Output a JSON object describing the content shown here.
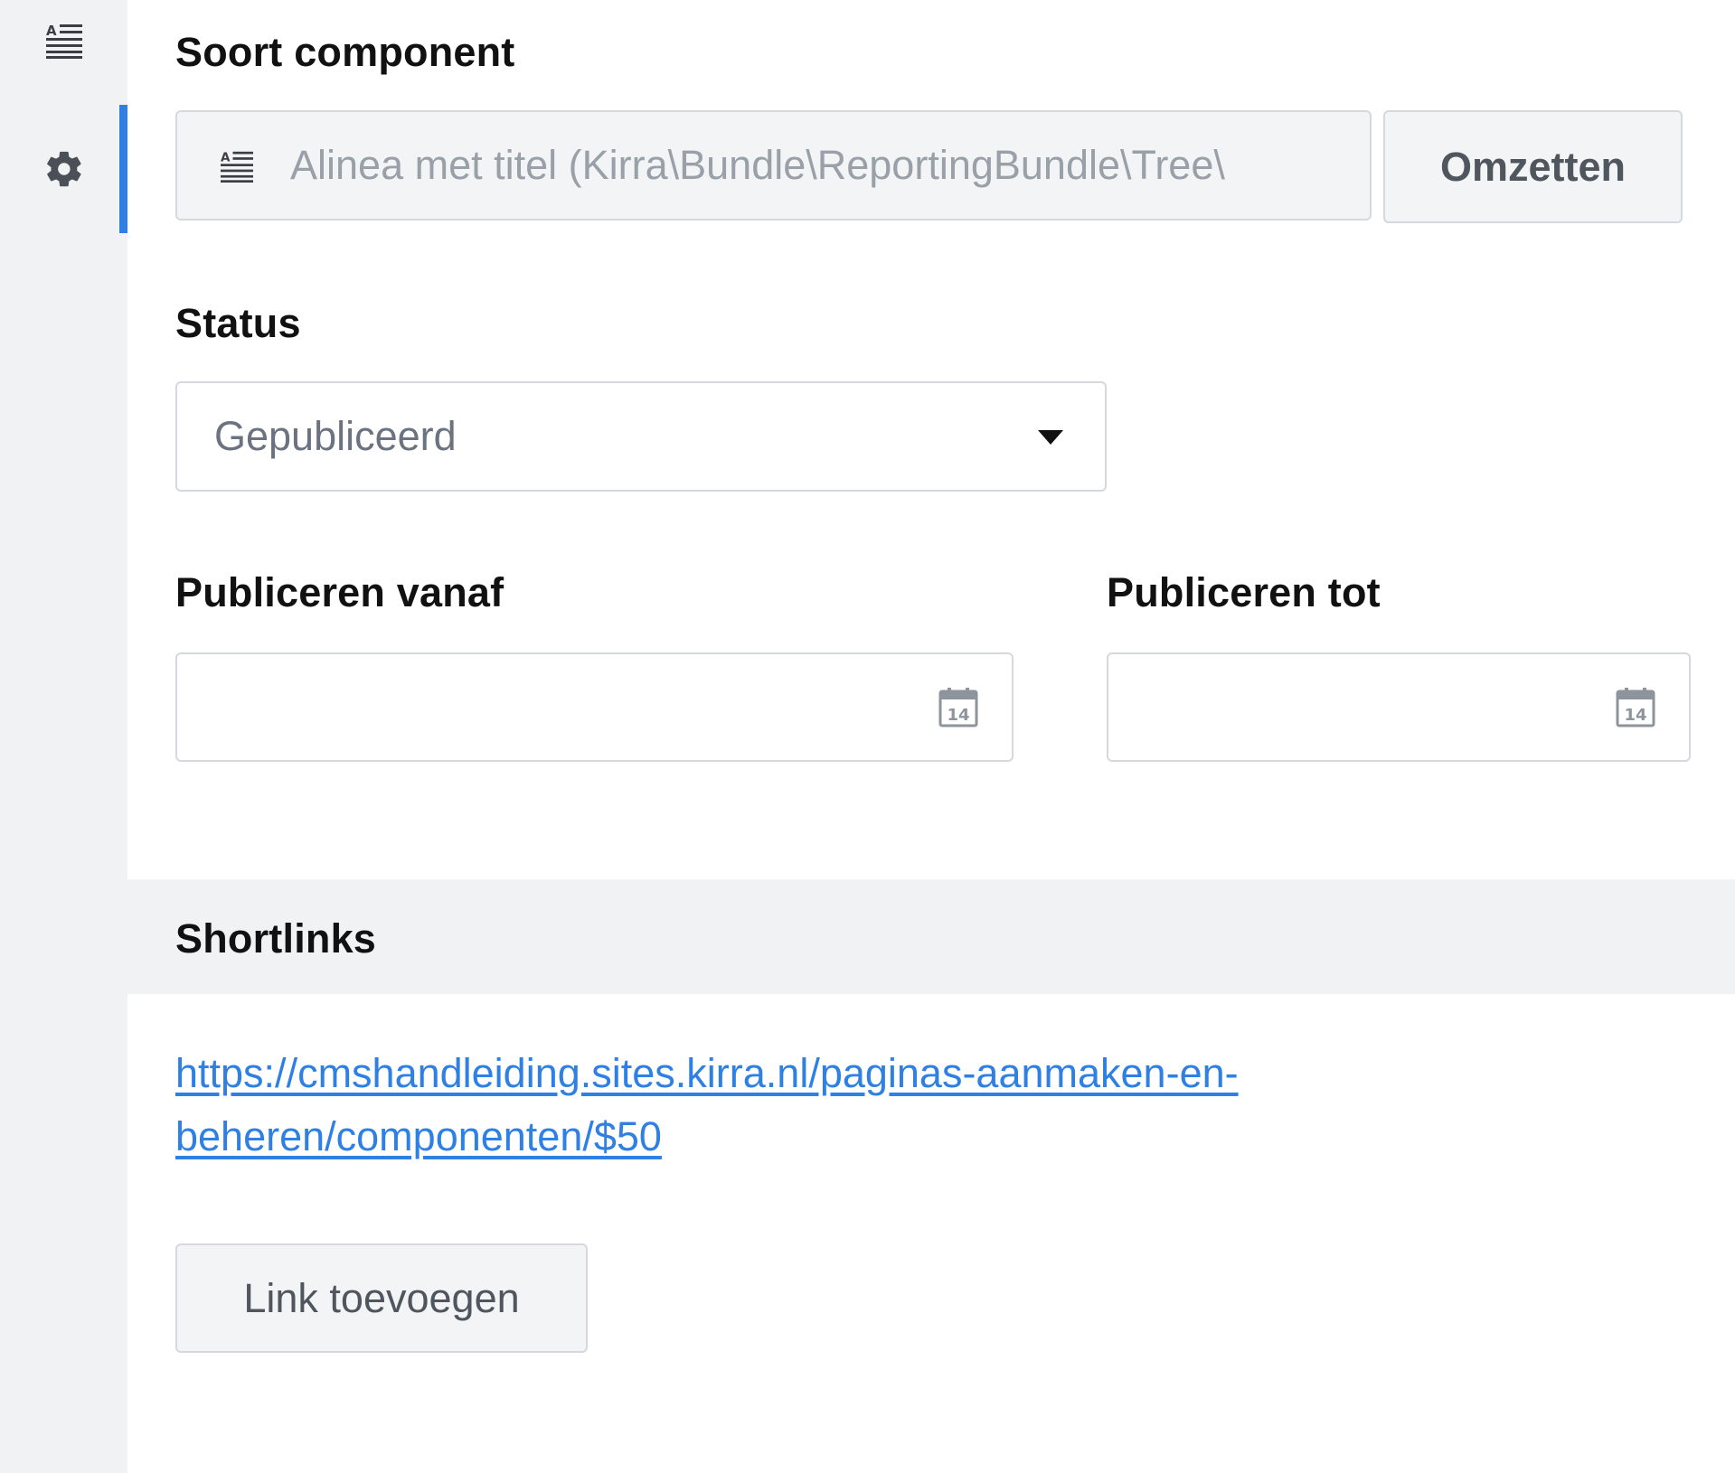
{
  "sidebar": {
    "items": [
      {
        "icon": "text-paragraph-icon"
      },
      {
        "icon": "gear-icon",
        "active": true
      }
    ]
  },
  "component_type": {
    "label": "Soort component",
    "value": "Alinea met titel (Kirra\\Bundle\\ReportingBundle\\Tree\\",
    "icon": "text-paragraph-icon",
    "convert_button": "Omzetten"
  },
  "status": {
    "label": "Status",
    "selected": "Gepubliceerd"
  },
  "publish_from": {
    "label": "Publiceren vanaf",
    "value": "",
    "icon": "calendar-icon",
    "icon_day": "14"
  },
  "publish_until": {
    "label": "Publiceren tot",
    "value": "",
    "icon": "calendar-icon",
    "icon_day": "14"
  },
  "shortlinks": {
    "title": "Shortlinks",
    "links": [
      {
        "line1": "https://cmshandleiding.sites.kirra.nl/paginas-aanmaken-en-",
        "line2": "beheren/componenten/$50"
      }
    ],
    "add_button": "Link toevoegen"
  },
  "colors": {
    "accent": "#2f80e4",
    "sidebar_bg": "#f1f2f4",
    "border": "#d5d8dc"
  }
}
